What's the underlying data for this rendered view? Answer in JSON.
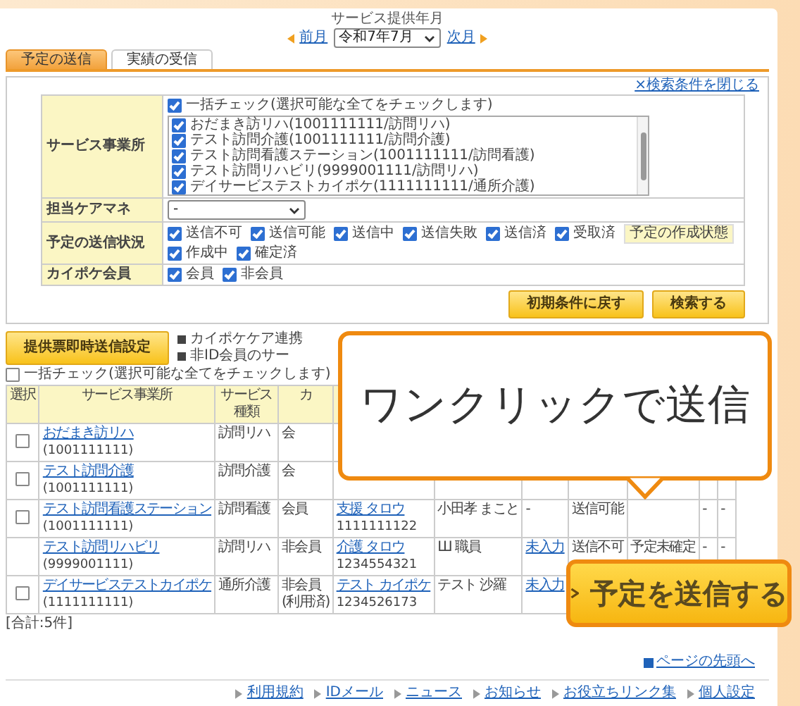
{
  "period": {
    "label": "サービス提供年月",
    "prev": "前月",
    "month": "令和7年7月",
    "next": "次月"
  },
  "tabs": [
    {
      "label": "予定の送信",
      "selected": true
    },
    {
      "label": "実績の受信",
      "selected": false
    }
  ],
  "search": {
    "close_link": "×検索条件を閉じる",
    "office": {
      "label": "サービス事業所",
      "check_all": {
        "label": "一括チェック(選択可能な全てをチェックします)",
        "checked": true
      },
      "options": [
        {
          "label": "おだまき訪リハ(1001111111/訪問リハ)",
          "checked": true
        },
        {
          "label": "テスト訪問介護(1001111111/訪問介護)",
          "checked": true
        },
        {
          "label": "テスト訪問看護ステーション(1001111111/訪問看護)",
          "checked": true
        },
        {
          "label": "テスト訪問リハビリ(9999001111/訪問リハ)",
          "checked": true
        },
        {
          "label": "デイサービステストカイポケ(1111111111/通所介護)",
          "checked": true
        }
      ]
    },
    "care_manager": {
      "label": "担当ケアマネ",
      "value": "-"
    },
    "send_status": {
      "label": "予定の送信状況",
      "options": [
        {
          "label": "送信不可",
          "checked": true
        },
        {
          "label": "送信可能",
          "checked": true
        },
        {
          "label": "送信中",
          "checked": true
        },
        {
          "label": "送信失敗",
          "checked": true
        },
        {
          "label": "送信済",
          "checked": true
        },
        {
          "label": "受取済",
          "checked": true
        }
      ]
    },
    "create_status": {
      "label": "予定の作成状態",
      "options": [
        {
          "label": "作成中",
          "checked": true
        },
        {
          "label": "確定済",
          "checked": true
        }
      ]
    },
    "membership": {
      "label": "カイポケ会員",
      "options": [
        {
          "label": "会員",
          "checked": true
        },
        {
          "label": "非会員",
          "checked": true
        }
      ]
    },
    "buttons": [
      {
        "label": "初期条件に戻す"
      },
      {
        "label": "検索する"
      }
    ]
  },
  "instant_button": "提供票即時送信設定",
  "notes": [
    "カイポケケア連携",
    "非ID会員のサー"
  ],
  "table_check_all": {
    "label": "一括チェック(選択可能な全てをチェックします)",
    "checked": false
  },
  "table": {
    "columns": [
      "選択",
      "サービス事業所",
      "サービス種類",
      "カ"
    ],
    "rows": [
      {
        "has_checkbox": true,
        "selected": false,
        "office": "おだまき訪リハ",
        "office_code": "(1001111111)",
        "service": "訪問リハ",
        "member": "会"
      },
      {
        "has_checkbox": true,
        "selected": false,
        "office": "テスト訪問介護",
        "office_code": "(1001111111)",
        "service": "訪問介護",
        "member": "会"
      },
      {
        "has_checkbox": true,
        "selected": false,
        "office": "テスト訪問看護ステーション",
        "office_code": "(1001111111)",
        "service": "訪問看護",
        "member": "会員",
        "user": "支援 タロウ",
        "user_code": "1111111122",
        "staff": "小田孝 まこと",
        "entry": "-",
        "send_status": "送信可能",
        "col_9": "-",
        "col_10": "-"
      },
      {
        "has_checkbox": false,
        "selected": false,
        "office": "テスト訪問リハビリ",
        "office_code": "(9999001111)",
        "service": "訪問リハ",
        "member": "非会員",
        "user": "介護 タロウ",
        "user_code": "1234554321",
        "staff": "Ш 職員",
        "entry_link": "未入力",
        "send_status": "送信不可",
        "create_status": "予定未確定",
        "col_9": "-",
        "col_10": "-"
      },
      {
        "has_checkbox": true,
        "selected": false,
        "office": "デイサービステストカイポケ",
        "office_code": "(1111111111)",
        "service": "通所介護",
        "member": "非会員",
        "member_note": "(利用済)",
        "user": "テスト カイポケ",
        "user_code": "1234526173",
        "staff": "テスト 沙羅",
        "entry_link": "未入力"
      }
    ]
  },
  "total": "[合計:5件]",
  "page_top": "ページの先頭へ",
  "footer_links": [
    "利用規約",
    "IDメール",
    "ニュース",
    "お知らせ",
    "お役立ちリンク集",
    "個人設定"
  ],
  "callout": "ワンクリックで送信",
  "send_button": "予定を送信する"
}
